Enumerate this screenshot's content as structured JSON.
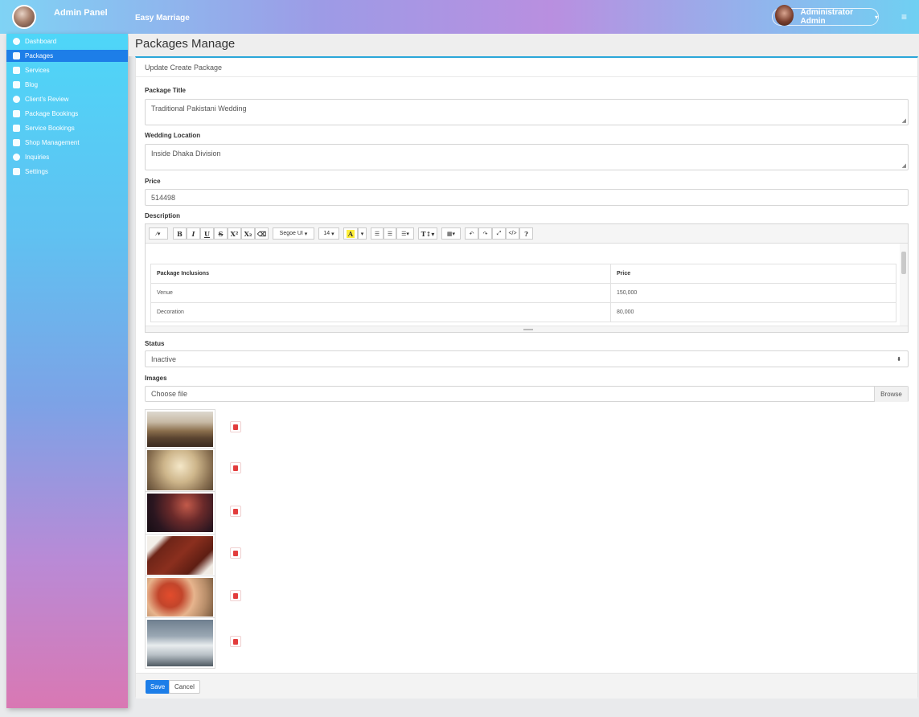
{
  "header": {
    "brand": "Admin Panel",
    "app_title": "Easy Marriage",
    "user_name": "Administrator Admin"
  },
  "sidebar": {
    "items": [
      {
        "label": "Dashboard",
        "icon": "dashboard-icon"
      },
      {
        "label": "Packages",
        "icon": "layers-icon",
        "active": true
      },
      {
        "label": "Services",
        "icon": "gift-icon"
      },
      {
        "label": "Blog",
        "icon": "blog-icon"
      },
      {
        "label": "Client's Review",
        "icon": "comments-icon"
      },
      {
        "label": "Package Bookings",
        "icon": "clipboard-icon"
      },
      {
        "label": "Service Bookings",
        "icon": "calendar-icon"
      },
      {
        "label": "Shop Management",
        "icon": "gift-icon"
      },
      {
        "label": "Inquiries",
        "icon": "question-icon"
      },
      {
        "label": "Settings",
        "icon": "cogs-icon"
      }
    ]
  },
  "page": {
    "title": "Packages Manage",
    "card_title": "Update Create Package"
  },
  "form": {
    "title_label": "Package Title",
    "title_value": "Traditional Pakistani Wedding",
    "location_label": "Wedding Location",
    "location_value": "Inside Dhaka Division",
    "price_label": "Price",
    "price_value": "514498",
    "description_label": "Description",
    "status_label": "Status",
    "status_value": "Inactive",
    "images_label": "Images",
    "file_placeholder": "Choose file",
    "browse_label": "Browse"
  },
  "editor": {
    "font_name": "Segoe UI",
    "font_size": "14",
    "table": {
      "headers": [
        "Package Inclusions",
        "Price"
      ],
      "rows": [
        [
          "Venue",
          "150,000"
        ],
        [
          "Decoration",
          "80,000"
        ]
      ]
    }
  },
  "images": [
    {
      "name": "wedding-table-decor-image"
    },
    {
      "name": "stage-decoration-image"
    },
    {
      "name": "night-celebration-image"
    },
    {
      "name": "wedding-card-image"
    },
    {
      "name": "bride-portrait-image"
    },
    {
      "name": "decorated-car-image"
    }
  ],
  "actions": {
    "save": "Save",
    "cancel": "Cancel"
  },
  "colors": {
    "primary": "#1d7ee8",
    "danger": "#e23c3c",
    "accent_line": "#2aa6d9"
  }
}
